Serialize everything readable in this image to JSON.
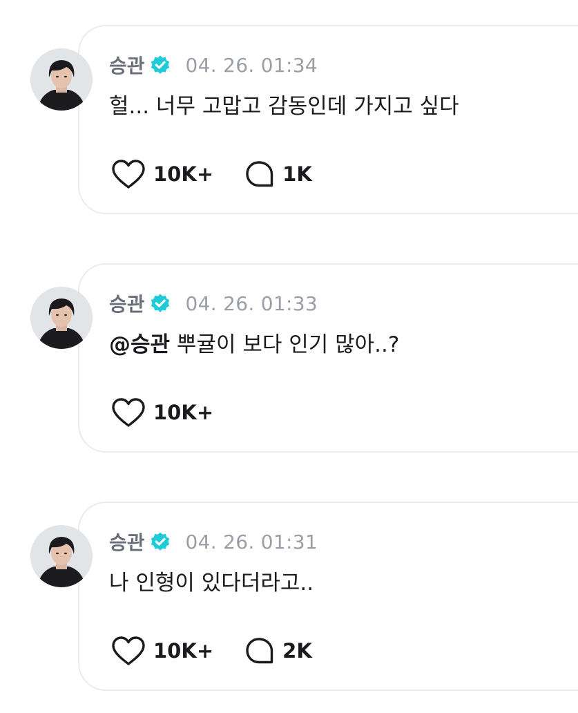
{
  "colors": {
    "verified_badge": "#1ecbd7",
    "card_border": "#ececf0",
    "name_text": "#6a6e78",
    "timestamp_text": "#9a9ea6",
    "body_text": "#1b1b1f"
  },
  "posts": [
    {
      "author": "승관",
      "verified_icon": "verified-badge-icon",
      "timestamp": "04. 26. 01:34",
      "mention": "",
      "text": "헐... 너무 고맙고 감동인데 가지고 싶다",
      "likes_icon": "heart-icon",
      "likes": "10K+",
      "comments_icon": "comment-bubble-icon",
      "comments": "1K"
    },
    {
      "author": "승관",
      "verified_icon": "verified-badge-icon",
      "timestamp": "04. 26. 01:33",
      "mention": "@승관",
      "text": " 뿌귤이 보다 인기 많아..?",
      "likes_icon": "heart-icon",
      "likes": "10K+"
    },
    {
      "author": "승관",
      "verified_icon": "verified-badge-icon",
      "timestamp": "04. 26. 01:31",
      "mention": "",
      "text": "나 인형이 있다더라고..",
      "likes_icon": "heart-icon",
      "likes": "10K+",
      "comments_icon": "comment-bubble-icon",
      "comments": "2K"
    }
  ]
}
